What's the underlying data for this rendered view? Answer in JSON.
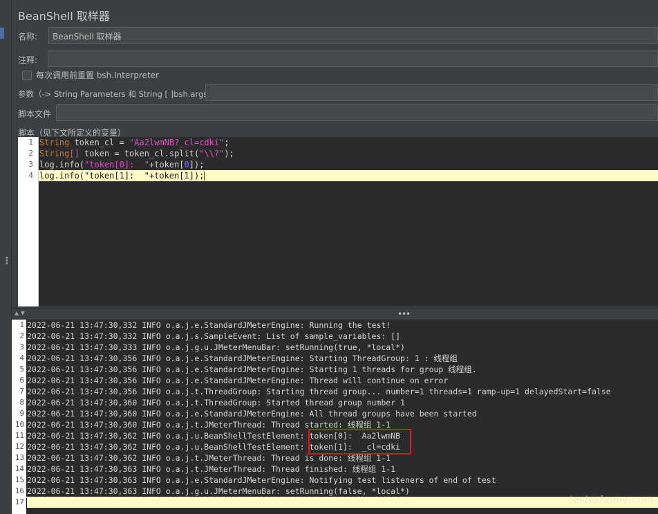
{
  "panel": {
    "title": "BeanShell 取样器",
    "name_label": "名称:",
    "name_value": "BeanShell 取样器",
    "comment_label": "注释:",
    "comment_value": "",
    "reset_checkbox_label": "每次调用前重置 bsh.Interpreter",
    "reset_checked": false,
    "params_label": "参数（-> String Parameters 和 String [ ]bsh.args）",
    "params_value": "",
    "script_file_label": "脚本文件",
    "script_file_value": "",
    "script_label": "脚本（见下文所定义的变量）"
  },
  "script": {
    "line_numbers": [
      "1",
      "2",
      "3",
      "4"
    ],
    "active_line": 4
  },
  "log": {
    "line_numbers": [
      "1",
      "2",
      "3",
      "4",
      "5",
      "6",
      "7",
      "8",
      "9",
      "10",
      "11",
      "12",
      "13",
      "14",
      "15",
      "16",
      "17"
    ],
    "lines": [
      "2022-06-21 13:47:30,332 INFO o.a.j.e.StandardJMeterEngine: Running the test!",
      "2022-06-21 13:47:30,332 INFO o.a.j.s.SampleEvent: List of sample_variables: []",
      "2022-06-21 13:47:30,333 INFO o.a.j.g.u.JMeterMenuBar: setRunning(true, *local*)",
      "2022-06-21 13:47:30,356 INFO o.a.j.e.StandardJMeterEngine: Starting ThreadGroup: 1 : 线程组",
      "2022-06-21 13:47:30,356 INFO o.a.j.e.StandardJMeterEngine: Starting 1 threads for group 线程组.",
      "2022-06-21 13:47:30,356 INFO o.a.j.e.StandardJMeterEngine: Thread will continue on error",
      "2022-06-21 13:47:30,356 INFO o.a.j.t.ThreadGroup: Starting thread group... number=1 threads=1 ramp-up=1 delayedStart=false",
      "2022-06-21 13:47:30,360 INFO o.a.j.t.ThreadGroup: Started thread group number 1",
      "2022-06-21 13:47:30,360 INFO o.a.j.e.StandardJMeterEngine: All thread groups have been started",
      "2022-06-21 13:47:30,360 INFO o.a.j.t.JMeterThread: Thread started: 线程组 1-1",
      "2022-06-21 13:47:30,362 INFO o.a.j.u.BeanShellTestElement: token[0]:  Aa2lwmNB",
      "2022-06-21 13:47:30,362 INFO o.a.j.u.BeanShellTestElement: token[1]:  _cl=cdki",
      "2022-06-21 13:47:30,362 INFO o.a.j.t.JMeterThread: Thread is done: 线程组 1-1",
      "2022-06-21 13:47:30,363 INFO o.a.j.t.JMeterThread: Thread finished: 线程组 1-1",
      "2022-06-21 13:47:30,363 INFO o.a.j.e.StandardJMeterEngine: Notifying test listeners of end of test",
      "2022-06-21 13:47:30,363 INFO o.a.j.g.u.JMeterMenuBar: setRunning(false, *local*)",
      ""
    ]
  },
  "code_tokens": {
    "l1_kw": "String",
    "l1_a": " token_cl = ",
    "l1_str": "\"Aa2lwmNB?_cl=cdki\"",
    "l1_b": ";",
    "l2_kw": "String",
    "l2_brk": "[]",
    "l2_a": " token = token_cl.split(",
    "l2_str": "\"\\\\?\"",
    "l2_b": ");",
    "l3_a": "log.info(",
    "l3_str": "\"token[0]:  \"",
    "l3_b": "+token[",
    "l3_idx": "0",
    "l3_c": "]);",
    "l4_a": "log.info(",
    "l4_str": "\"token[1]:  \"",
    "l4_b": "+token[",
    "l4_idx": "1",
    "l4_c": "]);"
  },
  "watermark": "testerhome.com",
  "colors": {
    "highlight_box": "#e0141e",
    "active_line_bg": "#fffbc4",
    "keyword": "#cc7832",
    "string": "#e04cc9"
  }
}
